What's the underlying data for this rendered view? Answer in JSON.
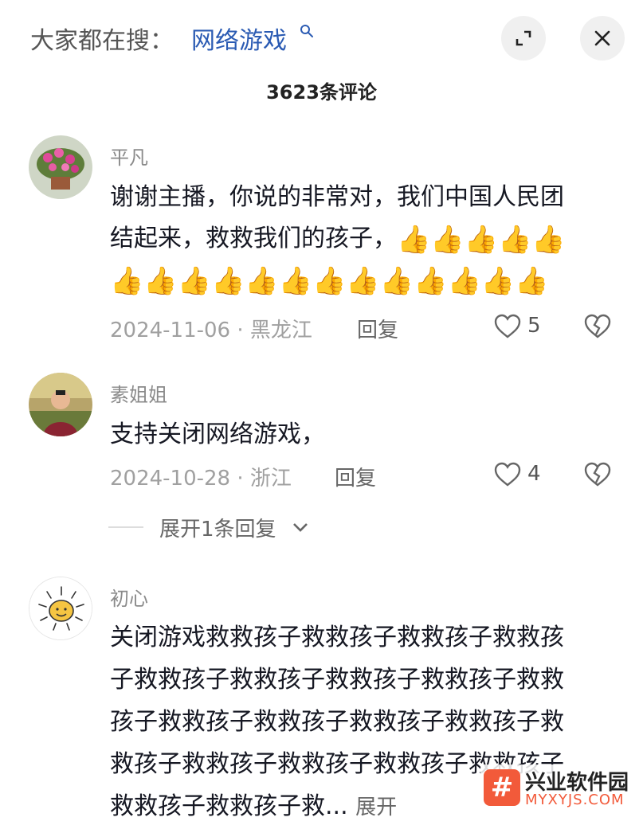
{
  "header": {
    "search_prefix": "大家都在搜：",
    "search_term": "网络游戏",
    "comment_count": "3623条评论"
  },
  "icons": {
    "search": "search-icon",
    "expand": "expand-icon",
    "close": "close-icon",
    "like": "heart-icon",
    "dislike": "broken-heart-icon"
  },
  "comments": [
    {
      "user": "平凡",
      "text_line1": "谢谢主播，你说的非常对，我们中国人民团",
      "text_line2": "结起来，救救我们的孩子，",
      "emoji": "👍",
      "emoji_count_line2": 5,
      "emoji_count_line3": 13,
      "date": "2024-11-06",
      "location": "黑龙江",
      "reply": "回复",
      "likes": "5"
    },
    {
      "user": "素姐姐",
      "text": "支持关闭网络游戏，",
      "date": "2024-10-28",
      "location": "浙江",
      "reply": "回复",
      "likes": "4",
      "expand_replies": "展开1条回复"
    },
    {
      "user": "初心",
      "lines": [
        "关闭游戏救救孩子救救孩子救救孩子救救孩",
        "子救救孩子救救孩子救救孩子救救孩子救救",
        "孩子救救孩子救救孩子救救孩子救救孩子救",
        "救孩子救救孩子救救孩子救救孩子救救孩子",
        "救救孩子救救孩子救..."
      ],
      "more": "展开"
    }
  ],
  "watermark": {
    "logo": "#",
    "title": "兴业软件园",
    "subtitle": "MYXYJS.COM"
  },
  "colors": {
    "accent_link": "#2b5bb3",
    "watermark": "#f25a3a"
  }
}
